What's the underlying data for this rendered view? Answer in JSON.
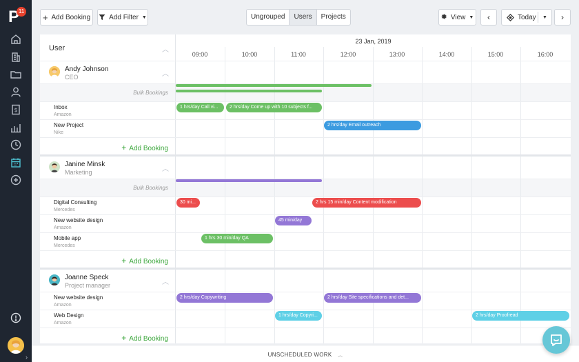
{
  "app": {
    "logo_letter": "P",
    "notification_count": "11",
    "colors": {
      "rail": "#1f2631",
      "rail_icon": "#b8bec8",
      "rail_active": "#4fc2d2",
      "green": "#6cc065",
      "blue": "#3c9be0",
      "red": "#ec4d4d",
      "purple": "#9377d6",
      "cyan": "#5fd0e6",
      "add_green": "#3fa83f"
    }
  },
  "sidebar": {
    "icons": [
      "home-icon",
      "building-icon",
      "folder-icon",
      "person-icon",
      "invoice-icon",
      "bar-chart-icon",
      "clock-icon",
      "calendar-icon",
      "add-circle-icon"
    ],
    "active": "calendar-icon",
    "bottom_icons": [
      "alert-icon",
      "avatar",
      "expand-icon"
    ]
  },
  "toolbar": {
    "add_booking": "Add Booking",
    "add_filter": "Add Filter",
    "view_tabs": [
      {
        "label": "Ungrouped",
        "active": false
      },
      {
        "label": "Users",
        "active": true
      },
      {
        "label": "Projects",
        "active": false
      }
    ],
    "view": "View",
    "today": "Today"
  },
  "schedule": {
    "user_header": "User",
    "date": "23 Jan, 2019",
    "hours": [
      "09:00",
      "10:00",
      "11:00",
      "12:00",
      "13:00",
      "14:00",
      "15:00",
      "16:00"
    ],
    "bulk_label": "Bulk Bookings",
    "add_booking": "Add Booking",
    "people": [
      {
        "name": "Andy Johnson",
        "role": "CEO",
        "projects": [
          {
            "name": "Inbox",
            "client": "Amazon"
          },
          {
            "name": "New Project",
            "client": "Nike"
          }
        ]
      },
      {
        "name": "Janine Minsk",
        "role": "Marketing",
        "projects": [
          {
            "name": "Digital Consulting",
            "client": "Mercedes"
          },
          {
            "name": "New website design",
            "client": "Amazon"
          },
          {
            "name": "Mobile app",
            "client": "Mercedes"
          }
        ]
      },
      {
        "name": "Joanne Speck",
        "role": "Project manager",
        "projects": [
          {
            "name": "New website design",
            "client": "Amazon"
          },
          {
            "name": "Web Design",
            "client": "Amazon"
          }
        ]
      }
    ],
    "bookings": [
      {
        "label": "1 hrs/day Call vi...",
        "color": "green",
        "start": "09:00",
        "end": "10:00"
      },
      {
        "label": "2 hrs/day Come up with 10 subjects f...",
        "color": "green",
        "start": "10:00",
        "end": "12:00"
      },
      {
        "label": "2 hrs/day Email outreach",
        "color": "blue",
        "start": "12:00",
        "end": "14:00"
      },
      {
        "label": "30 mi...",
        "color": "red",
        "start": "09:00",
        "end": "09:30"
      },
      {
        "label": "2 hrs 15 min/day Content modification",
        "color": "red",
        "start": "12:00",
        "end": "14:15"
      },
      {
        "label": "45 min/day",
        "color": "purple",
        "start": "11:00",
        "end": "11:45"
      },
      {
        "label": "1 hrs 30 min/day QA",
        "color": "green",
        "start": "09:30",
        "end": "11:00"
      },
      {
        "label": "2 hrs/day Copywriting",
        "color": "purple",
        "start": "09:00",
        "end": "11:00"
      },
      {
        "label": "2 hrs/day Site specifications and det...",
        "color": "purple",
        "start": "12:00",
        "end": "14:00"
      },
      {
        "label": "1 hrs/day Copyri...",
        "color": "cyan",
        "start": "11:00",
        "end": "12:00"
      },
      {
        "label": "2 hrs/day Proofread",
        "color": "cyan",
        "start": "15:00",
        "end": "17:00"
      }
    ]
  },
  "footer": {
    "unscheduled": "UNSCHEDULED WORK"
  }
}
